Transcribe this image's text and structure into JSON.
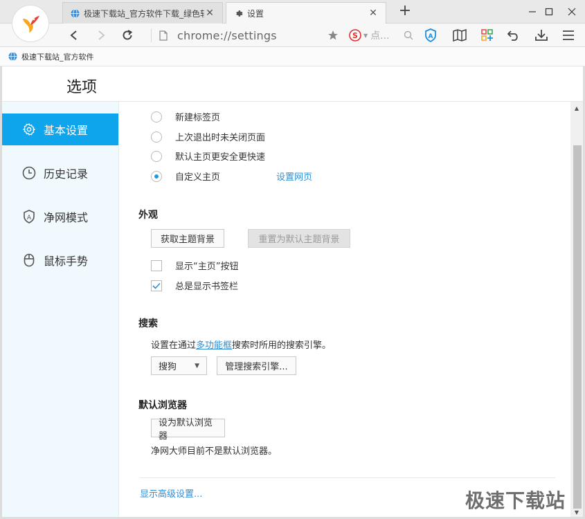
{
  "tabs": [
    {
      "title": "极速下载站_官方软件下载_绿色软"
    },
    {
      "title": "设置"
    }
  ],
  "address": {
    "url": "chrome://settings"
  },
  "search": {
    "placeholder": "点..."
  },
  "bookmarks": [
    {
      "label": "极速下载站_官方软件"
    }
  ],
  "page": {
    "title": "选项"
  },
  "sidebar": {
    "items": [
      {
        "label": "基本设置",
        "icon": "gear-icon",
        "active": true
      },
      {
        "label": "历史记录",
        "icon": "clock-icon",
        "active": false
      },
      {
        "label": "净网模式",
        "icon": "shield-icon",
        "active": false
      },
      {
        "label": "鼠标手势",
        "icon": "mouse-icon",
        "active": false
      }
    ]
  },
  "startup": {
    "options": [
      {
        "label": "新建标签页",
        "selected": false
      },
      {
        "label": "上次退出时未关闭页面",
        "selected": false
      },
      {
        "label": "默认主页更安全更快速",
        "selected": false
      },
      {
        "label": "自定义主页",
        "selected": true
      }
    ],
    "set_pages_link": "设置网页"
  },
  "appearance": {
    "title": "外观",
    "get_theme_button": "获取主题背景",
    "reset_theme_button": "重置为默认主题背景",
    "show_home_button": {
      "label": "显示“主页”按钮",
      "checked": false
    },
    "show_bookmarks_bar": {
      "label": "总是显示书签栏",
      "checked": true
    }
  },
  "search_section": {
    "title": "搜索",
    "desc_prefix": "设置在通过",
    "desc_link": "多功能框",
    "desc_suffix": "搜索时所用的搜索引擎。",
    "engine_selected": "搜狗",
    "manage_button": "管理搜索引擎..."
  },
  "default_browser": {
    "title": "默认浏览器",
    "set_button": "设为默认浏览器",
    "status": "净网大师目前不是默认浏览器。"
  },
  "advanced_link": "显示高级设置...",
  "watermark": "极速下载站",
  "colors": {
    "accent": "#0ea5ec",
    "link": "#2d8fd6",
    "sidebar_bg": "#f0f9fd"
  }
}
